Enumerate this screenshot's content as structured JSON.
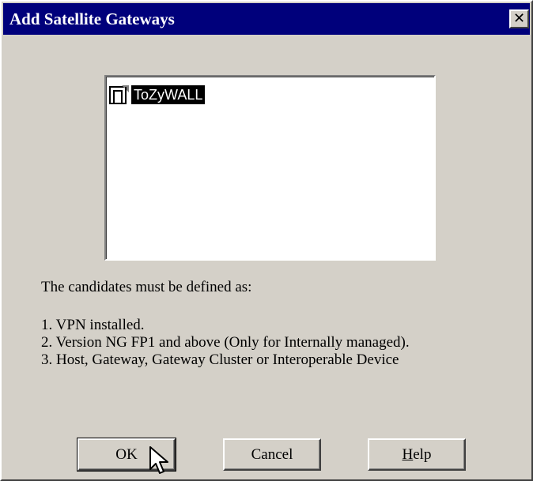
{
  "window": {
    "title": "Add Satellite Gateways",
    "close_glyph": "✕"
  },
  "list": {
    "items": [
      {
        "label": "ToZyWALL",
        "icon": "gateway-icon",
        "selected": true
      }
    ]
  },
  "info": {
    "heading": "The candidates must be defined as:",
    "lines": [
      "1. VPN installed.",
      "2. Version NG FP1 and above (Only for Internally managed).",
      "3. Host, Gateway, Gateway Cluster or Interoperable Device"
    ]
  },
  "buttons": {
    "ok": "OK",
    "cancel": "Cancel",
    "help_first": "H",
    "help_rest": "elp"
  },
  "colors": {
    "titlebar": "#00007b",
    "dialog_bg": "#d4d0c8",
    "selection_bg": "#000000"
  }
}
